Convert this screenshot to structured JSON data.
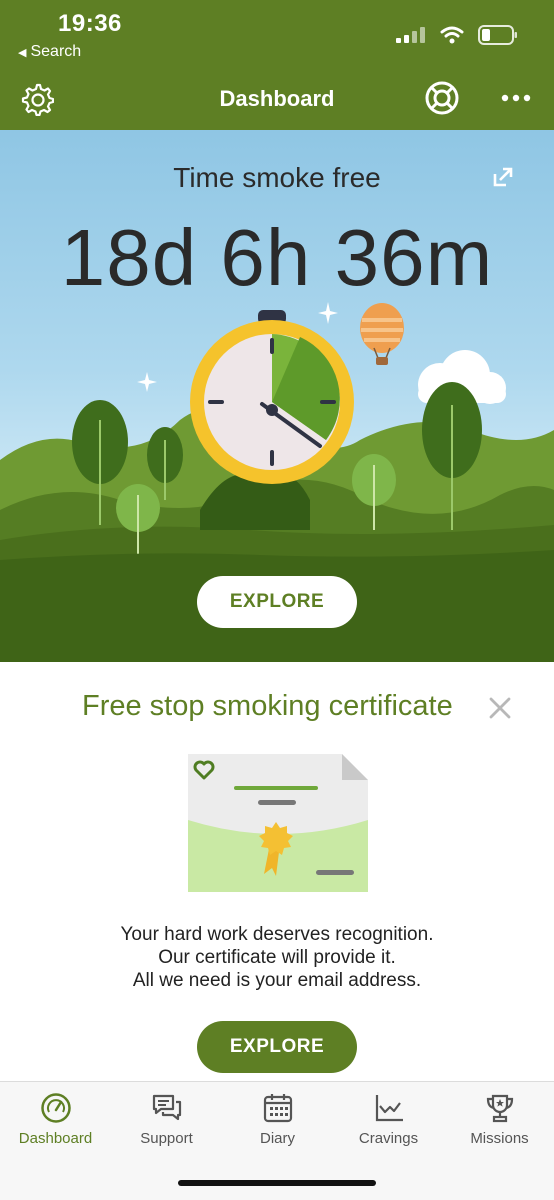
{
  "status_bar": {
    "time": "19:36",
    "back_label": "Search",
    "icons": [
      "cellular-signal-icon",
      "wifi-icon",
      "battery-icon"
    ]
  },
  "nav": {
    "title": "Dashboard",
    "left_icon": "gear-icon",
    "right_icons": [
      "lifebuoy-icon",
      "more-dots-icon"
    ]
  },
  "hero": {
    "title": "Time smoke free",
    "timer": "18d 6h 36m",
    "share_icon": "share-external-icon",
    "explore_label": "EXPLORE"
  },
  "certificate": {
    "title": "Free stop smoking certificate",
    "close_icon": "close-icon",
    "description_lines": [
      "Your hard work deserves recognition.",
      "Our certificate will provide it.",
      "All we need is your email address."
    ],
    "explore_label": "EXPLORE"
  },
  "tabs": [
    {
      "label": "Dashboard",
      "icon": "speedometer-icon",
      "active": true
    },
    {
      "label": "Support",
      "icon": "chat-bubbles-icon",
      "active": false
    },
    {
      "label": "Diary",
      "icon": "calendar-icon",
      "active": false
    },
    {
      "label": "Cravings",
      "icon": "line-chart-icon",
      "active": false
    },
    {
      "label": "Missions",
      "icon": "trophy-icon",
      "active": false
    }
  ],
  "colors": {
    "brand_green": "#5e7f24",
    "sky_blue": "#9fd0ea",
    "white": "#ffffff"
  }
}
